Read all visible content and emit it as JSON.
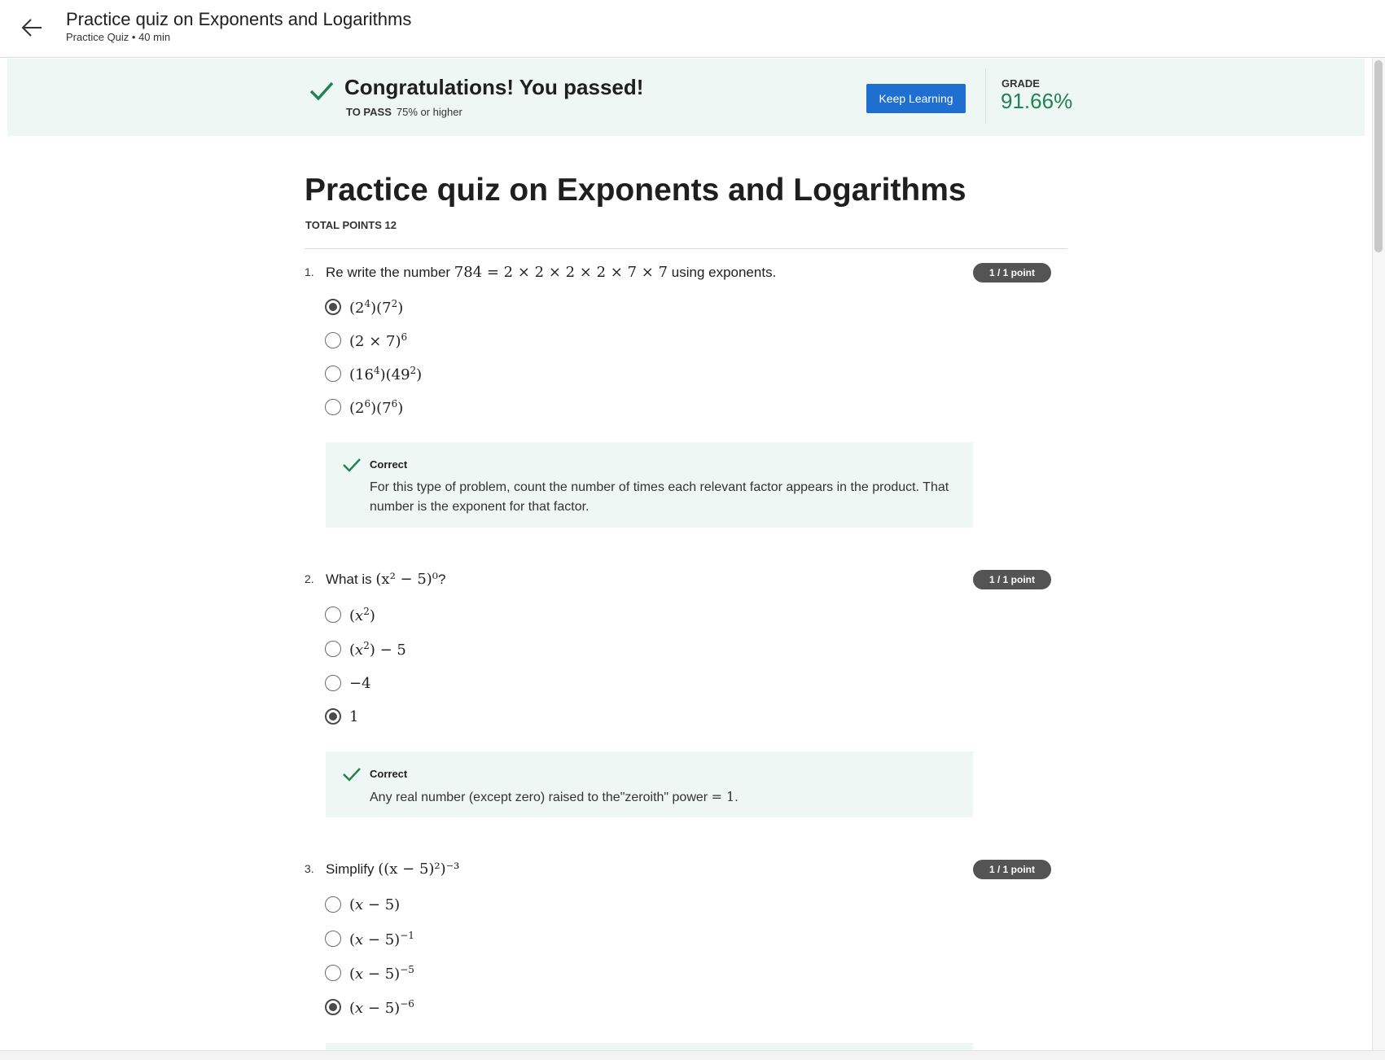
{
  "header": {
    "title": "Practice quiz on Exponents and Logarithms",
    "subtitle": "Practice Quiz • 40 min"
  },
  "banner": {
    "title": "Congratulations! You passed!",
    "to_pass_label": "TO PASS",
    "to_pass_value": "75% or higher",
    "keep_learning": "Keep Learning",
    "grade_label": "GRADE",
    "grade_value": "91.66%"
  },
  "quiz": {
    "title": "Practice quiz on Exponents and Logarithms",
    "total_points": "TOTAL POINTS 12",
    "questions": [
      {
        "number": "1.",
        "points": "1 / 1 point",
        "text_before": "Re write the number ",
        "math": "784 = 2 × 2 × 2 × 2 × 7 × 7",
        "text_after": " using exponents.",
        "options": [
          {
            "label": "(2⁴)(7²)",
            "selected": true
          },
          {
            "label": "(2 × 7)⁶",
            "selected": false
          },
          {
            "label": "(16⁴)(49²)",
            "selected": false
          },
          {
            "label": "(2⁶)(7⁶)",
            "selected": false
          }
        ],
        "feedback_title": "Correct",
        "feedback_text": "For this type of problem, count the number of times each relevant factor appears in the product. That number is the exponent for that factor."
      },
      {
        "number": "2.",
        "points": "1 / 1 point",
        "text_before": "What is ",
        "math": "(x² − 5)⁰",
        "text_after": "?",
        "options": [
          {
            "label": "(x²)",
            "selected": false
          },
          {
            "label": "(x²) − 5",
            "selected": false
          },
          {
            "label": "−4",
            "selected": false
          },
          {
            "label": "1",
            "selected": true
          }
        ],
        "feedback_title": "Correct",
        "feedback_text_before": "Any real number (except zero) raised to the\"zeroith\" power ",
        "feedback_math": "= 1",
        "feedback_text_after": "."
      },
      {
        "number": "3.",
        "points": "1 / 1 point",
        "text_before": "Simplify ",
        "math": "((x − 5)²)⁻³",
        "text_after": "",
        "options": [
          {
            "label": "(x − 5)",
            "selected": false
          },
          {
            "label": "(x − 5)⁻¹",
            "selected": false
          },
          {
            "label": "(x − 5)⁻⁵",
            "selected": false
          },
          {
            "label": "(x − 5)⁻⁶",
            "selected": true
          }
        ]
      }
    ]
  }
}
